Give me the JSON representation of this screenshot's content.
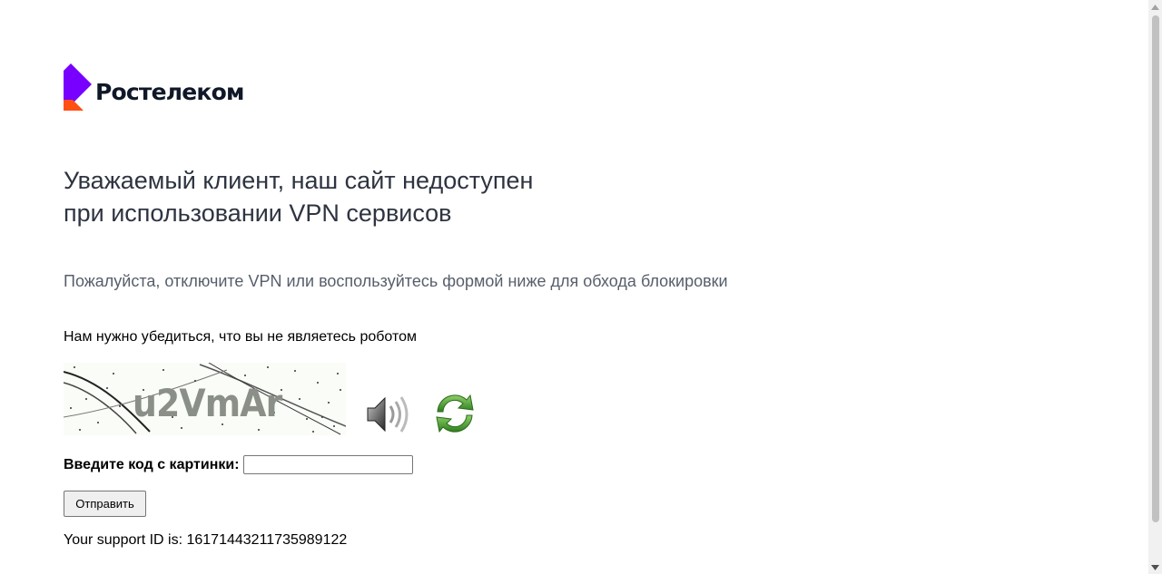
{
  "brand": {
    "name": "Ростелеком",
    "colors": {
      "purple": "#7700ff",
      "orange": "#ff4f12"
    }
  },
  "headline": {
    "line1": "Уважаемый клиент, наш сайт недоступен",
    "line2": "при использовании VPN сервисов"
  },
  "subline": "Пожалуйста, отключите VPN или воспользуйтесь формой ниже для обхода блокировки",
  "captcha": {
    "prompt": "Нам нужно убедиться, что вы не являетесь роботом",
    "image_text": "u2VmAr",
    "audio_icon": "speaker-icon",
    "refresh_icon": "refresh-icon"
  },
  "form": {
    "code_label": "Введите код с картинки:",
    "code_value": "",
    "submit_label": "Отправить"
  },
  "support": {
    "text": "Your support ID is: 16171443211735989122"
  }
}
